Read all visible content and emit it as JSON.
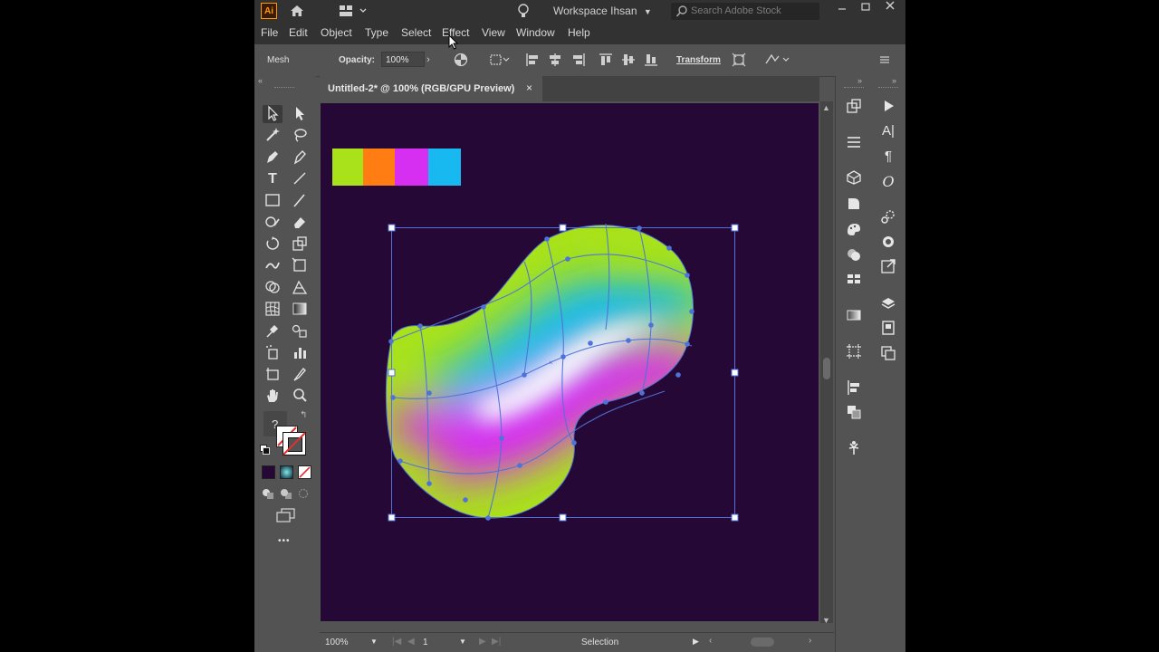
{
  "titlebar": {
    "app_logo": "Ai",
    "workspace_label": "Workspace Ihsan",
    "search_placeholder": "Search Adobe Stock"
  },
  "menu": [
    "File",
    "Edit",
    "Object",
    "Type",
    "Select",
    "Effect",
    "View",
    "Window",
    "Help"
  ],
  "controlbar": {
    "tool_name": "Mesh",
    "opacity_label": "Opacity:",
    "opacity_value": "100%",
    "transform_label": "Transform"
  },
  "document": {
    "tab_title": "Untitled-2* @ 100% (RGB/GPU Preview)",
    "tab_close": "×"
  },
  "swatches": [
    "#a9e21a",
    "#ff7d12",
    "#d62ff1",
    "#17b9f0"
  ],
  "colors": {
    "artboard_bg": "#250835",
    "selection": "#4f72d9",
    "mesh_green": "#a9e21a",
    "mesh_cyan": "#17b9f0",
    "mesh_magenta": "#d62ff1",
    "mesh_white": "#ffffff"
  },
  "toolbar": {
    "question_mark": "?",
    "more_tools": "•••"
  },
  "statusbar": {
    "zoom": "100%",
    "artboard_number": "1",
    "status": "Selection"
  }
}
